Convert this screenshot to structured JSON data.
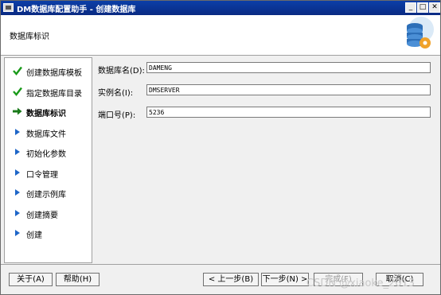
{
  "window": {
    "title": "DM数据库配置助手 - 创建数据库",
    "min_glyph": "_",
    "max_glyph": "□",
    "close_glyph": "✕"
  },
  "header": {
    "title": "数据库标识"
  },
  "steps": [
    {
      "label": "创建数据库模板",
      "status": "done"
    },
    {
      "label": "指定数据库目录",
      "status": "done"
    },
    {
      "label": "数据库标识",
      "status": "current"
    },
    {
      "label": "数据库文件",
      "status": "pending"
    },
    {
      "label": "初始化参数",
      "status": "pending"
    },
    {
      "label": "口令管理",
      "status": "pending"
    },
    {
      "label": "创建示例库",
      "status": "pending"
    },
    {
      "label": "创建摘要",
      "status": "pending"
    },
    {
      "label": "创建",
      "status": "pending"
    }
  ],
  "form": {
    "db_name": {
      "label": "数据库名(D):",
      "value": "DAMENG"
    },
    "instance_name": {
      "label": "实例名(I):",
      "value": "DMSERVER"
    },
    "port": {
      "label": "端口号(P):",
      "value": "5236"
    }
  },
  "buttons": {
    "about": "关于(A)",
    "help": "帮助(H)",
    "prev": "< 上一步(B)",
    "next": "下一步(N) >",
    "finish": "完成(F)",
    "cancel": "取消(C)"
  },
  "watermark": "CSDN @xiaoke_2013",
  "colors": {
    "check": "#1a9a1a",
    "arrow": "#1a7a1a",
    "bullet": "#1e66c8",
    "titlebar": "#0b3fa8"
  }
}
